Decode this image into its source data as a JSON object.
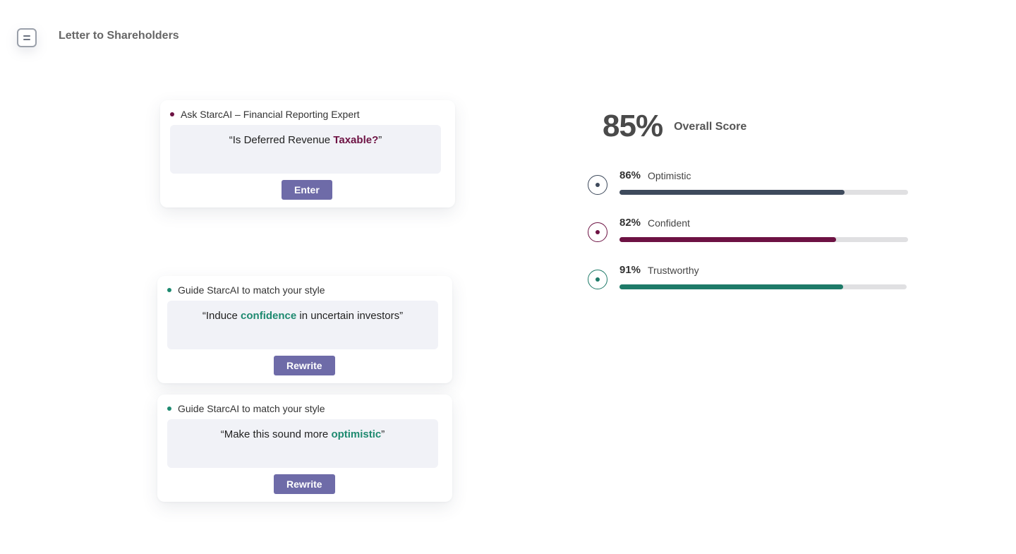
{
  "header": {
    "menu_icon": "menu-icon",
    "title": "Letter to Shareholders"
  },
  "ask_card": {
    "heading": "Ask StarcAI – Financial Reporting Expert",
    "dot_color": "#6d1243",
    "prompt_pre": "“Is Deferred Revenue ",
    "prompt_highlight": "Taxable?",
    "prompt_post": "”",
    "highlight_color": "#6d1243",
    "button_label": "Enter"
  },
  "style_cards": [
    {
      "heading": "Guide StarcAI to match your style",
      "dot_color": "#1e8a70",
      "prompt_pre": "“Induce ",
      "prompt_highlight": "confidence",
      "prompt_post": " in uncertain investors”",
      "highlight_color": "#1e8a70",
      "button_label": "Rewrite"
    },
    {
      "heading": "Guide StarcAI to match your style",
      "dot_color": "#1e8a70",
      "prompt_pre": "“Make this sound more ",
      "prompt_highlight": "optimistic",
      "prompt_post": "”",
      "highlight_color": "#1e8a70",
      "button_label": "Rewrite"
    }
  ],
  "scores": {
    "overall_value": "85%",
    "overall_label": "Overall Score",
    "metrics": [
      {
        "pct": "86%",
        "label": "Optimistic",
        "fill_fraction": 0.78,
        "color": "#3e4a5c"
      },
      {
        "pct": "82%",
        "label": "Confident",
        "fill_fraction": 0.75,
        "color": "#6d1243"
      },
      {
        "pct": "91%",
        "label": "Trustworthy",
        "fill_fraction": 0.78,
        "color": "#1e7a68"
      }
    ]
  }
}
